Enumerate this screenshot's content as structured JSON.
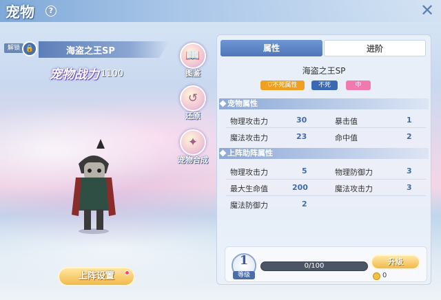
{
  "header": {
    "title": "宠物",
    "help_symbol": "?",
    "close_symbol": "✕"
  },
  "pet": {
    "unlock_label": "解锁",
    "name": "海盗之王SP",
    "power_label": "宠物战力",
    "power_value": "1100"
  },
  "side_buttons": [
    {
      "label": "图鉴",
      "icon": "book-icon"
    },
    {
      "label": "还原",
      "icon": "restore-icon"
    },
    {
      "label": "宠物合成",
      "icon": "compose-icon"
    }
  ],
  "deploy_button": "上阵设置",
  "tabs": [
    {
      "label": "属性"
    },
    {
      "label": "进阶"
    }
  ],
  "panel": {
    "pet_name": "海盗之王SP",
    "tags": [
      {
        "label": "不死属性",
        "color": "#f0a020"
      },
      {
        "label": "不死",
        "color": "#3a69b4"
      },
      {
        "label": "中",
        "color": "#f07ab0"
      }
    ],
    "pet_attrs_title": "宠物属性",
    "pet_attrs": [
      {
        "name": "物理攻击力",
        "value": "30"
      },
      {
        "name": "暴击值",
        "value": "1"
      },
      {
        "name": "魔法攻击力",
        "value": "23"
      },
      {
        "name": "命中值",
        "value": "2"
      }
    ],
    "support_title": "上阵助阵属性",
    "support_attrs": [
      {
        "name": "物理攻击力",
        "value": "5"
      },
      {
        "name": "物理防御力",
        "value": "3"
      },
      {
        "name": "最大生命值",
        "value": "200"
      },
      {
        "name": "魔法攻击力",
        "value": "3"
      },
      {
        "name": "魔法防御力",
        "value": "2"
      }
    ]
  },
  "level": {
    "value": "1",
    "label": "等级",
    "xp_text": "0/100",
    "xp_fraction": 0.0,
    "upgrade_label": "升级",
    "coin_value": "0"
  }
}
